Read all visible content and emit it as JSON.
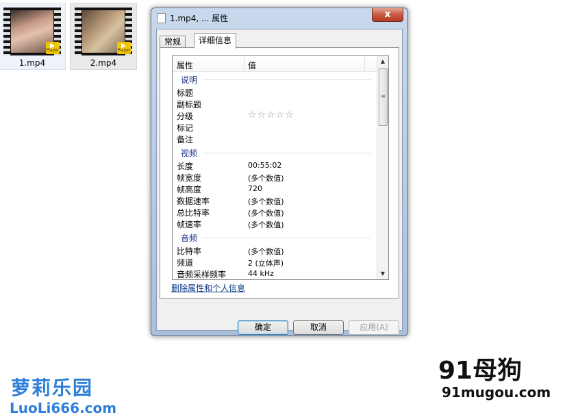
{
  "files": [
    {
      "name": "1.mp4",
      "badge": "Player"
    },
    {
      "name": "2.mp4",
      "badge": "Player"
    }
  ],
  "dialog": {
    "title": "1.mp4, ... 属性",
    "close_glyph": "x",
    "tabs": [
      "常规",
      "详细信息"
    ],
    "active_tab": "详细信息",
    "columns": {
      "property": "属性",
      "value": "值"
    },
    "groups": [
      {
        "name": "说明",
        "rows": [
          {
            "p": "标题",
            "v": ""
          },
          {
            "p": "副标题",
            "v": ""
          },
          {
            "p": "分级",
            "v": "☆☆☆☆☆"
          },
          {
            "p": "标记",
            "v": ""
          },
          {
            "p": "备注",
            "v": ""
          }
        ]
      },
      {
        "name": "视频",
        "rows": [
          {
            "p": "长度",
            "v": "00:55:02"
          },
          {
            "p": "帧宽度",
            "v": "(多个数值)"
          },
          {
            "p": "帧高度",
            "v": "720"
          },
          {
            "p": "数据速率",
            "v": "(多个数值)"
          },
          {
            "p": "总比特率",
            "v": "(多个数值)"
          },
          {
            "p": "帧速率",
            "v": "(多个数值)"
          }
        ]
      },
      {
        "name": "音频",
        "rows": [
          {
            "p": "比特率",
            "v": "(多个数值)"
          },
          {
            "p": "频道",
            "v": "2 (立体声)"
          },
          {
            "p": "音频采样频率",
            "v": "44 kHz"
          }
        ]
      }
    ],
    "remove_link": "删除属性和个人信息",
    "buttons": {
      "ok": "确定",
      "cancel": "取消",
      "apply": "应用(A)"
    }
  },
  "watermarks": {
    "left_title": "萝莉乐园",
    "left_url": "LuoLi666.com",
    "right_title": "91母狗",
    "right_url": "91mugou.com"
  }
}
